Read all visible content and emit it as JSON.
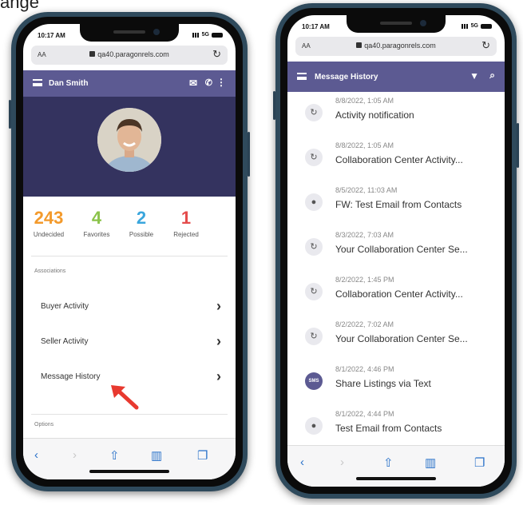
{
  "caption": "ange",
  "left_phone": {
    "status": {
      "time": "10:17 AM",
      "network": "5G"
    },
    "browser": {
      "aa_label": "AA",
      "url": "qa40.paragonrels.com",
      "reload_icon": "reload-icon"
    },
    "appbar": {
      "title": "Dan Smith",
      "icons": [
        "menu-icon",
        "mail-icon",
        "phone-icon",
        "more-vert-icon"
      ]
    },
    "stats": [
      {
        "value": "243",
        "label": "Undecided",
        "color": "#f39a2c"
      },
      {
        "value": "4",
        "label": "Favorites",
        "color": "#8bc34a"
      },
      {
        "value": "2",
        "label": "Possible",
        "color": "#3aa6dd"
      },
      {
        "value": "1",
        "label": "Rejected",
        "color": "#e44c4c"
      }
    ],
    "associations_label": "Associations",
    "menu": [
      {
        "label": "Buyer Activity"
      },
      {
        "label": "Seller Activity"
      },
      {
        "label": "Message History"
      }
    ],
    "options_label": "Options",
    "toolbar": [
      "back-icon",
      "forward-icon",
      "share-icon",
      "bookmarks-icon",
      "tabs-icon"
    ]
  },
  "right_phone": {
    "status": {
      "time": "10:17 AM",
      "network": "5G"
    },
    "browser": {
      "aa_label": "AA",
      "url": "qa40.paragonrels.com",
      "reload_icon": "reload-icon"
    },
    "appbar": {
      "title": "Message History",
      "icons": [
        "menu-icon",
        "filter-icon",
        "search-icon"
      ]
    },
    "messages": [
      {
        "date": "8/8/2022, 1:05 AM",
        "subject": "Activity notification",
        "icon": "activity-icon"
      },
      {
        "date": "8/8/2022, 1:05 AM",
        "subject": "Collaboration Center Activity...",
        "icon": "activity-icon"
      },
      {
        "date": "8/5/2022, 11:03 AM",
        "subject": "FW: Test Email from Contacts",
        "icon": "person-icon"
      },
      {
        "date": "8/3/2022, 7:03 AM",
        "subject": "Your Collaboration Center Se...",
        "icon": "activity-icon"
      },
      {
        "date": "8/2/2022, 1:45 PM",
        "subject": "Collaboration Center Activity...",
        "icon": "activity-icon"
      },
      {
        "date": "8/2/2022, 7:02 AM",
        "subject": "Your Collaboration Center Se...",
        "icon": "activity-icon"
      },
      {
        "date": "8/1/2022, 4:46 PM",
        "subject": "Share Listings via Text",
        "icon": "sms-icon",
        "badge": "SMS"
      },
      {
        "date": "8/1/2022, 4:44 PM",
        "subject": "Test Email from Contacts",
        "icon": "person-icon"
      }
    ],
    "toolbar": [
      "back-icon",
      "forward-icon",
      "share-icon",
      "bookmarks-icon",
      "tabs-icon"
    ]
  }
}
